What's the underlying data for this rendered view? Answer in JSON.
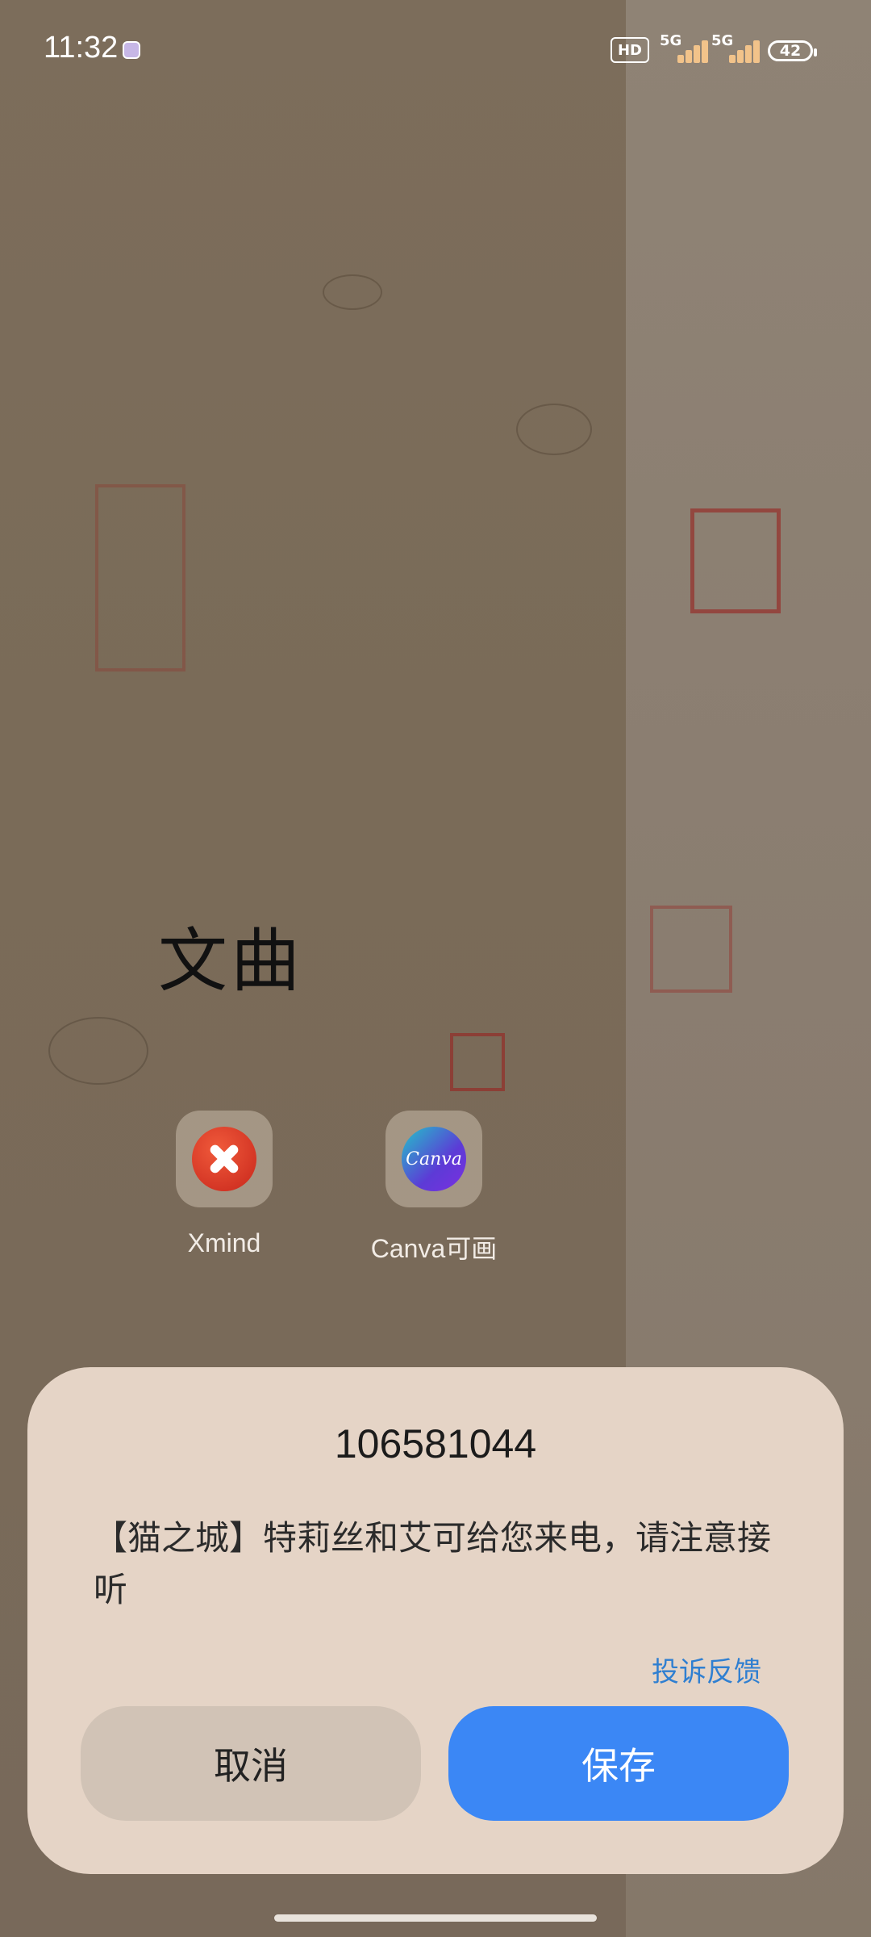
{
  "status_bar": {
    "time": "11:32",
    "hd_label": "HD",
    "network_1": "5G",
    "network_2": "5G",
    "battery": "42"
  },
  "home": {
    "folder_title": "文曲",
    "apps": [
      {
        "name": "Xmind",
        "icon": "xmind-icon"
      },
      {
        "name": "Canva可画",
        "icon": "canva-icon",
        "icon_text": "Canva"
      }
    ]
  },
  "dialog": {
    "title": "106581044",
    "message": "【猫之城】特莉丝和艾可给您来电，请注意接听",
    "feedback_link": "投诉反馈",
    "cancel_label": "取消",
    "save_label": "保存"
  },
  "colors": {
    "dialog_bg": "#e5d4c6",
    "primary": "#3b87f5",
    "link": "#2f7fd1"
  }
}
